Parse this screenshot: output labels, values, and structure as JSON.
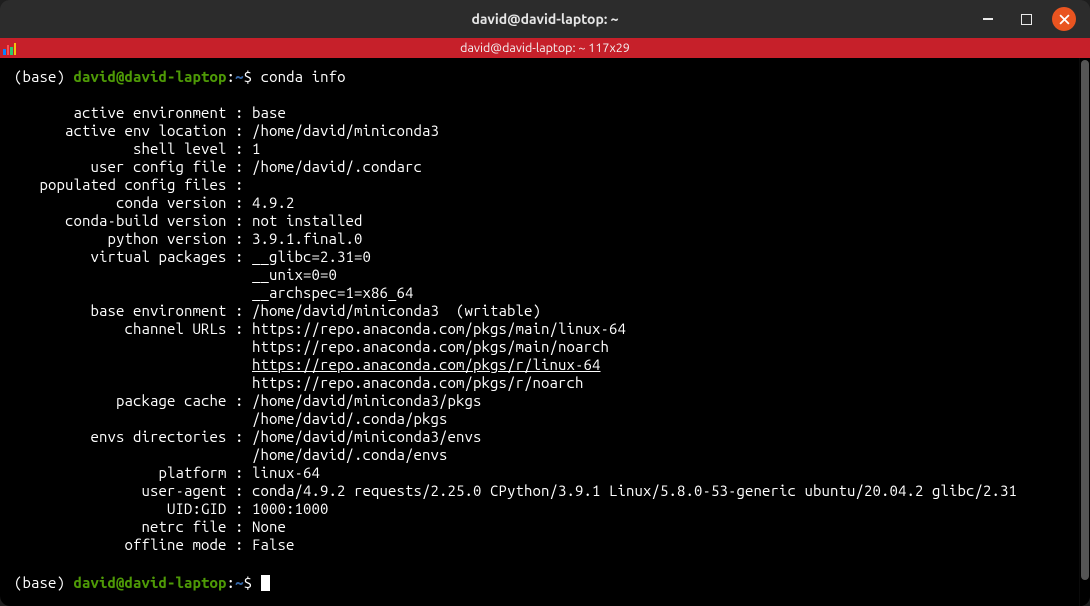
{
  "window": {
    "title": "david@david-laptop: ~"
  },
  "tab": {
    "label": "david@david-laptop: ~ 117x29"
  },
  "prompt": {
    "env": "(base)",
    "user_host": "david@david-laptop",
    "colon": ":",
    "path": "~",
    "dollar": "$"
  },
  "command1": "conda info",
  "info": {
    "rows": [
      {
        "label": "active environment",
        "values": [
          "base"
        ]
      },
      {
        "label": "active env location",
        "values": [
          "/home/david/miniconda3"
        ]
      },
      {
        "label": "shell level",
        "values": [
          "1"
        ]
      },
      {
        "label": "user config file",
        "values": [
          "/home/david/.condarc"
        ]
      },
      {
        "label": "populated config files",
        "values": [
          ""
        ]
      },
      {
        "label": "conda version",
        "values": [
          "4.9.2"
        ]
      },
      {
        "label": "conda-build version",
        "values": [
          "not installed"
        ]
      },
      {
        "label": "python version",
        "values": [
          "3.9.1.final.0"
        ]
      },
      {
        "label": "virtual packages",
        "values": [
          "__glibc=2.31=0",
          "__unix=0=0",
          "__archspec=1=x86_64"
        ]
      },
      {
        "label": "base environment",
        "values": [
          "/home/david/miniconda3  (writable)"
        ]
      },
      {
        "label": "channel URLs",
        "values": [
          "https://repo.anaconda.com/pkgs/main/linux-64",
          "https://repo.anaconda.com/pkgs/main/noarch",
          "https://repo.anaconda.com/pkgs/r/linux-64",
          "https://repo.anaconda.com/pkgs/r/noarch"
        ],
        "underline_index": 2
      },
      {
        "label": "package cache",
        "values": [
          "/home/david/miniconda3/pkgs",
          "/home/david/.conda/pkgs"
        ]
      },
      {
        "label": "envs directories",
        "values": [
          "/home/david/miniconda3/envs",
          "/home/david/.conda/envs"
        ]
      },
      {
        "label": "platform",
        "values": [
          "linux-64"
        ]
      },
      {
        "label": "user-agent",
        "values": [
          "conda/4.9.2 requests/2.25.0 CPython/3.9.1 Linux/5.8.0-53-generic ubuntu/20.04.2 glibc/2.31"
        ]
      },
      {
        "label": "UID:GID",
        "values": [
          "1000:1000"
        ]
      },
      {
        "label": "netrc file",
        "values": [
          "None"
        ]
      },
      {
        "label": "offline mode",
        "values": [
          "False"
        ]
      }
    ],
    "label_col_width": 24
  }
}
